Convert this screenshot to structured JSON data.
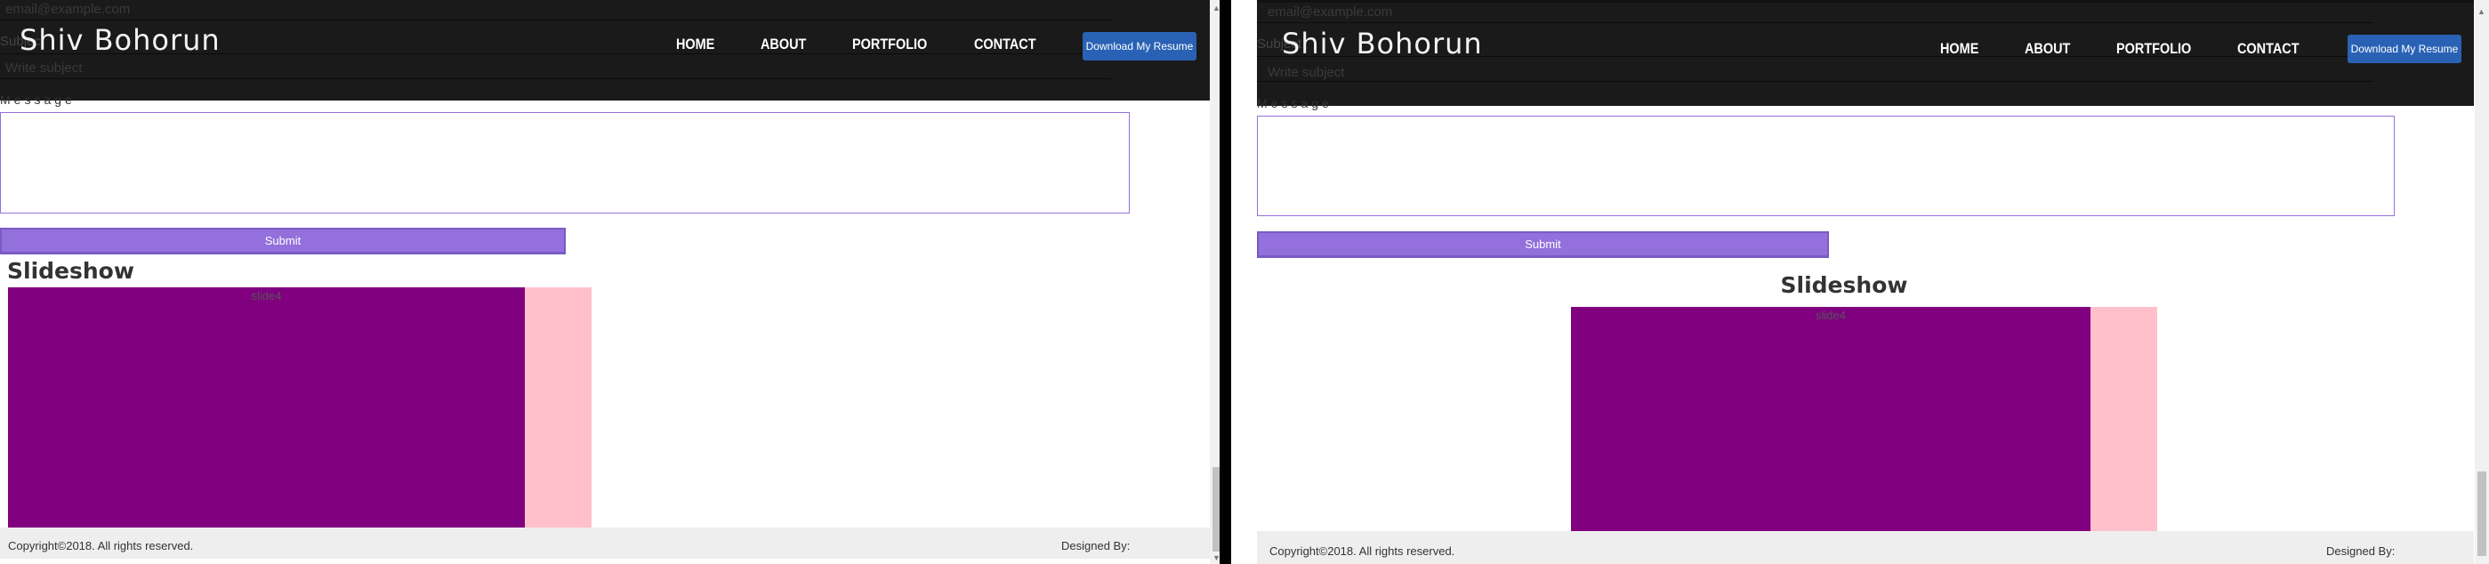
{
  "panels": [
    {
      "ghost": {
        "email_placeholder": "email@example.com",
        "subject_label": "Subject",
        "subject_placeholder": "Write subject"
      },
      "header": {
        "logo": "Shiv Bohorun",
        "nav": [
          "HOME",
          "ABOUT",
          "PORTFOLIO",
          "CONTACT"
        ],
        "resume_button": "Download My Resume"
      },
      "form": {
        "message_label": "Message",
        "submit_label": "Submit"
      },
      "slideshow": {
        "title": "Slideshow",
        "slide_label": "slide4"
      },
      "footer": {
        "copyright": "Copyright©2018. All rights reserved.",
        "designed_by": "Designed By:"
      }
    },
    {
      "ghost": {
        "email_placeholder": "email@example.com",
        "subject_label": "Subject",
        "subject_placeholder": "Write subject"
      },
      "header": {
        "logo": "Shiv Bohorun",
        "nav": [
          "HOME",
          "ABOUT",
          "PORTFOLIO",
          "CONTACT"
        ],
        "resume_button": "Download My Resume"
      },
      "form": {
        "message_label": "Message",
        "submit_label": "Submit"
      },
      "slideshow": {
        "title": "Slideshow",
        "slide_label": "slide4"
      },
      "footer": {
        "copyright": "Copyright©2018. All rights reserved.",
        "designed_by": "Designed By:"
      }
    }
  ],
  "colors": {
    "header_bg": "#1a1a1a",
    "accent_purple": "#9370db",
    "resume_blue": "#2962b5",
    "slide_purple": "#800080",
    "slide_pink": "#ffc0cb",
    "footer_bg": "#eeeeee"
  }
}
